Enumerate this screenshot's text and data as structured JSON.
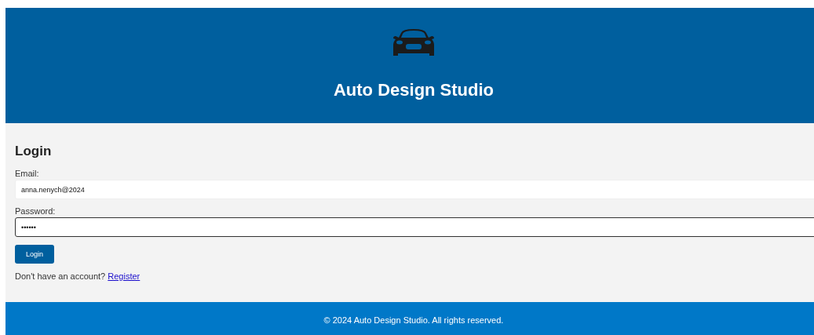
{
  "header": {
    "title": "Auto Design Studio"
  },
  "login": {
    "heading": "Login",
    "fields": [
      {
        "label": "Email:",
        "value": "anna.nenych@2024",
        "focused": false
      },
      {
        "label": "Password:",
        "value": "••••••",
        "focused": true
      }
    ],
    "button": "Login",
    "register_prompt": "Don't have an account?",
    "register_link": "Register"
  },
  "footer": {
    "text": "© 2024 Auto Design Studio. All rights reserved."
  }
}
